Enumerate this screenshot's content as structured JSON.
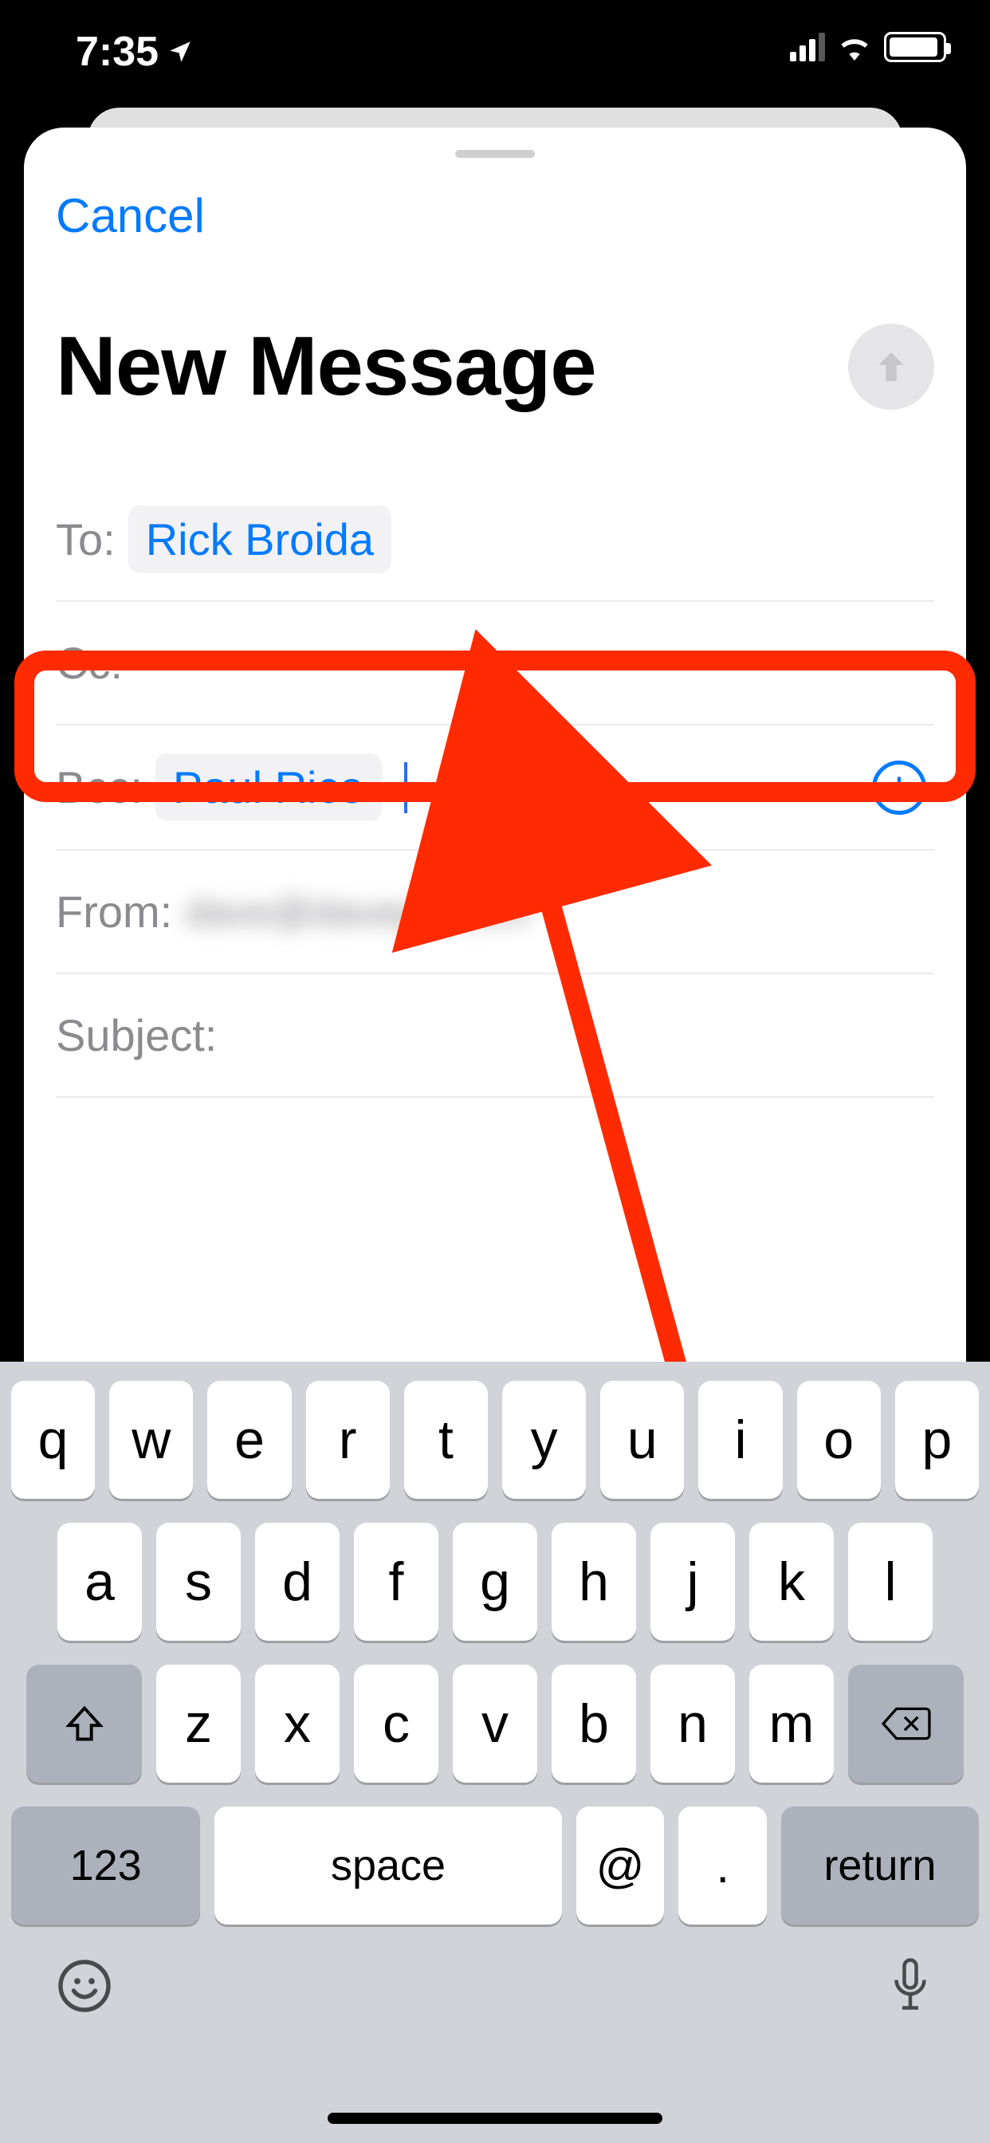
{
  "status": {
    "time": "7:35"
  },
  "nav": {
    "cancel": "Cancel"
  },
  "title": "New Message",
  "fields": {
    "to_label": "To:",
    "to_contact": "Rick Broida",
    "cc_label": "Cc:",
    "bcc_label": "Bcc:",
    "bcc_contact": "Paul Rice",
    "from_label": "From:",
    "from_value": "dave@daveph.com",
    "subject_label": "Subject:"
  },
  "keyboard": {
    "row1": [
      "q",
      "w",
      "e",
      "r",
      "t",
      "y",
      "u",
      "i",
      "o",
      "p"
    ],
    "row2": [
      "a",
      "s",
      "d",
      "f",
      "g",
      "h",
      "j",
      "k",
      "l"
    ],
    "row3": [
      "z",
      "x",
      "c",
      "v",
      "b",
      "n",
      "m"
    ],
    "num_key": "123",
    "space_key": "space",
    "at_key": "@",
    "dot_key": ".",
    "return_key": "return"
  },
  "annotation": {
    "highlight_field": "bcc",
    "arrow_target": "bcc"
  }
}
